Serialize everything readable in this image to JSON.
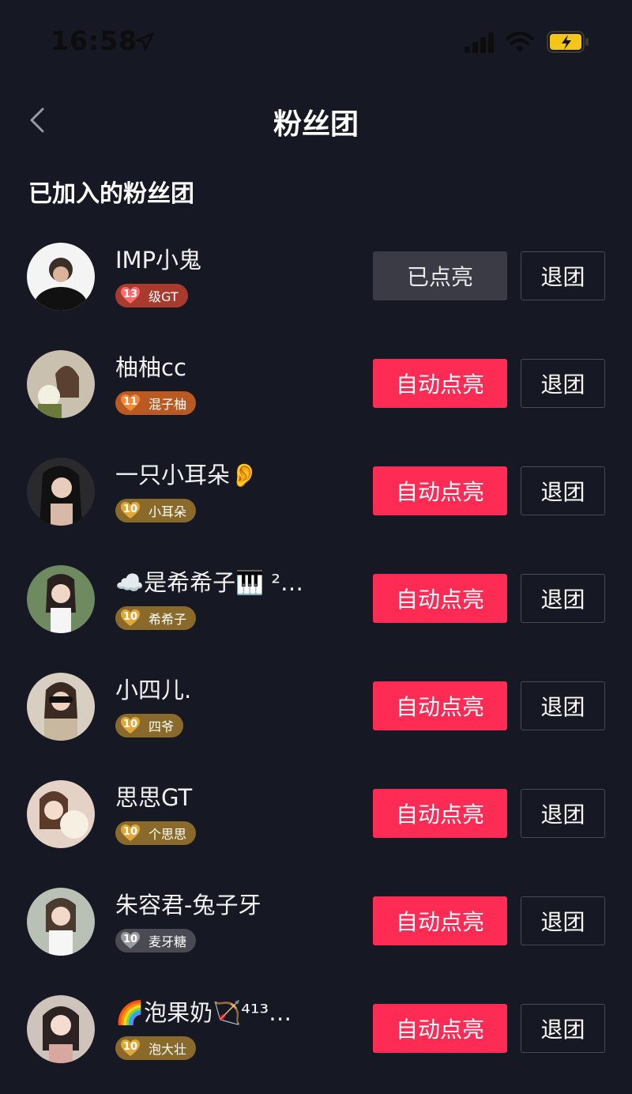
{
  "status_bar": {
    "time": "16:58"
  },
  "nav": {
    "title": "粉丝团"
  },
  "section_title": "已加入的粉丝团",
  "colors": {
    "accent": "#fe2c55",
    "background": "#161823",
    "lit_button": "#3a3b44"
  },
  "fan_clubs": [
    {
      "name": "IMP小鬼",
      "level": "13",
      "badge_text": "级GT",
      "badge_color": "#a83a2e",
      "heart_color": "#ff6b6b",
      "action_label": "已点亮",
      "action_style": "lit",
      "quit_label": "退团"
    },
    {
      "name": "柚柚cc",
      "level": "11",
      "badge_text": "混子柚",
      "badge_color": "#b85a22",
      "heart_color": "#f08a3a",
      "action_label": "自动点亮",
      "action_style": "auto",
      "quit_label": "退团"
    },
    {
      "name": "一只小耳朵👂",
      "level": "10",
      "badge_text": "小耳朵",
      "badge_color": "#8a6a2a",
      "heart_color": "#e0a83a",
      "action_label": "自动点亮",
      "action_style": "auto",
      "quit_label": "退团"
    },
    {
      "name": "☁️是希希子🎹 ²…",
      "level": "10",
      "badge_text": "希希子",
      "badge_color": "#8a6a2a",
      "heart_color": "#e0a83a",
      "action_label": "自动点亮",
      "action_style": "auto",
      "quit_label": "退团"
    },
    {
      "name": "小四儿.",
      "level": "10",
      "badge_text": "四爷",
      "badge_color": "#8a6a2a",
      "heart_color": "#e0a83a",
      "action_label": "自动点亮",
      "action_style": "auto",
      "quit_label": "退团"
    },
    {
      "name": "思思GT",
      "level": "10",
      "badge_text": "个思思",
      "badge_color": "#8a6a2a",
      "heart_color": "#e0a83a",
      "action_label": "自动点亮",
      "action_style": "auto",
      "quit_label": "退团"
    },
    {
      "name": "朱容君-兔子牙",
      "level": "10",
      "badge_text": "麦牙糖",
      "badge_color": "#4a4b52",
      "heart_color": "#9a9aa0",
      "action_label": "自动点亮",
      "action_style": "auto",
      "quit_label": "退团"
    },
    {
      "name": "🌈泡果奶🏹⁴¹³…",
      "level": "10",
      "badge_text": "泡大壮",
      "badge_color": "#8a6a2a",
      "heart_color": "#e0a83a",
      "action_label": "自动点亮",
      "action_style": "auto",
      "quit_label": "退团"
    }
  ]
}
